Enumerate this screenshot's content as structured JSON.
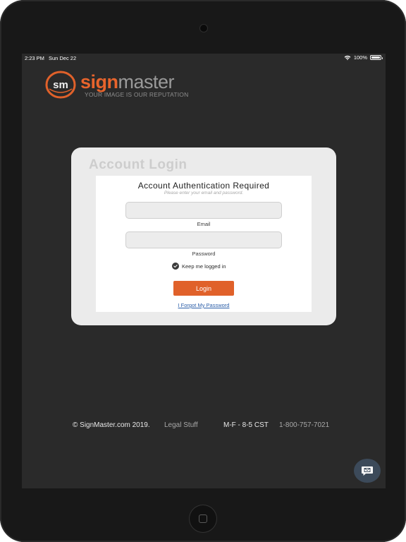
{
  "status_bar": {
    "time": "2:23 PM",
    "date": "Sun Dec 22",
    "battery": "100%"
  },
  "brand": {
    "logo_text": "sm",
    "name_bold": "sign",
    "name_light": "master",
    "tagline": "YOUR IMAGE IS OUR REPUTATION"
  },
  "login": {
    "heading": "Account Login",
    "title": "Account Authentication Required",
    "subtitle": "Please enter your email and password.",
    "email_label": "Email",
    "email_value": "",
    "password_label": "Password",
    "password_value": "",
    "keep_logged_in_label": "Keep me logged in",
    "keep_logged_in_checked": true,
    "login_button": "Login",
    "forgot_link": "I Forgot My Password"
  },
  "footer": {
    "copyright": "© SignMaster.com 2019.",
    "legal": "Legal Stuff",
    "hours": "M-F - 8-5 CST",
    "phone": "1-800-757-7021"
  },
  "colors": {
    "accent": "#e0612a",
    "screen_bg": "#2a2a2a",
    "link": "#2b5ea8",
    "chat_button": "#3c4a5a"
  },
  "icons": {
    "chat": "chat-bubble-icon",
    "wifi": "wifi-icon",
    "battery": "battery-icon",
    "check": "check-icon"
  }
}
